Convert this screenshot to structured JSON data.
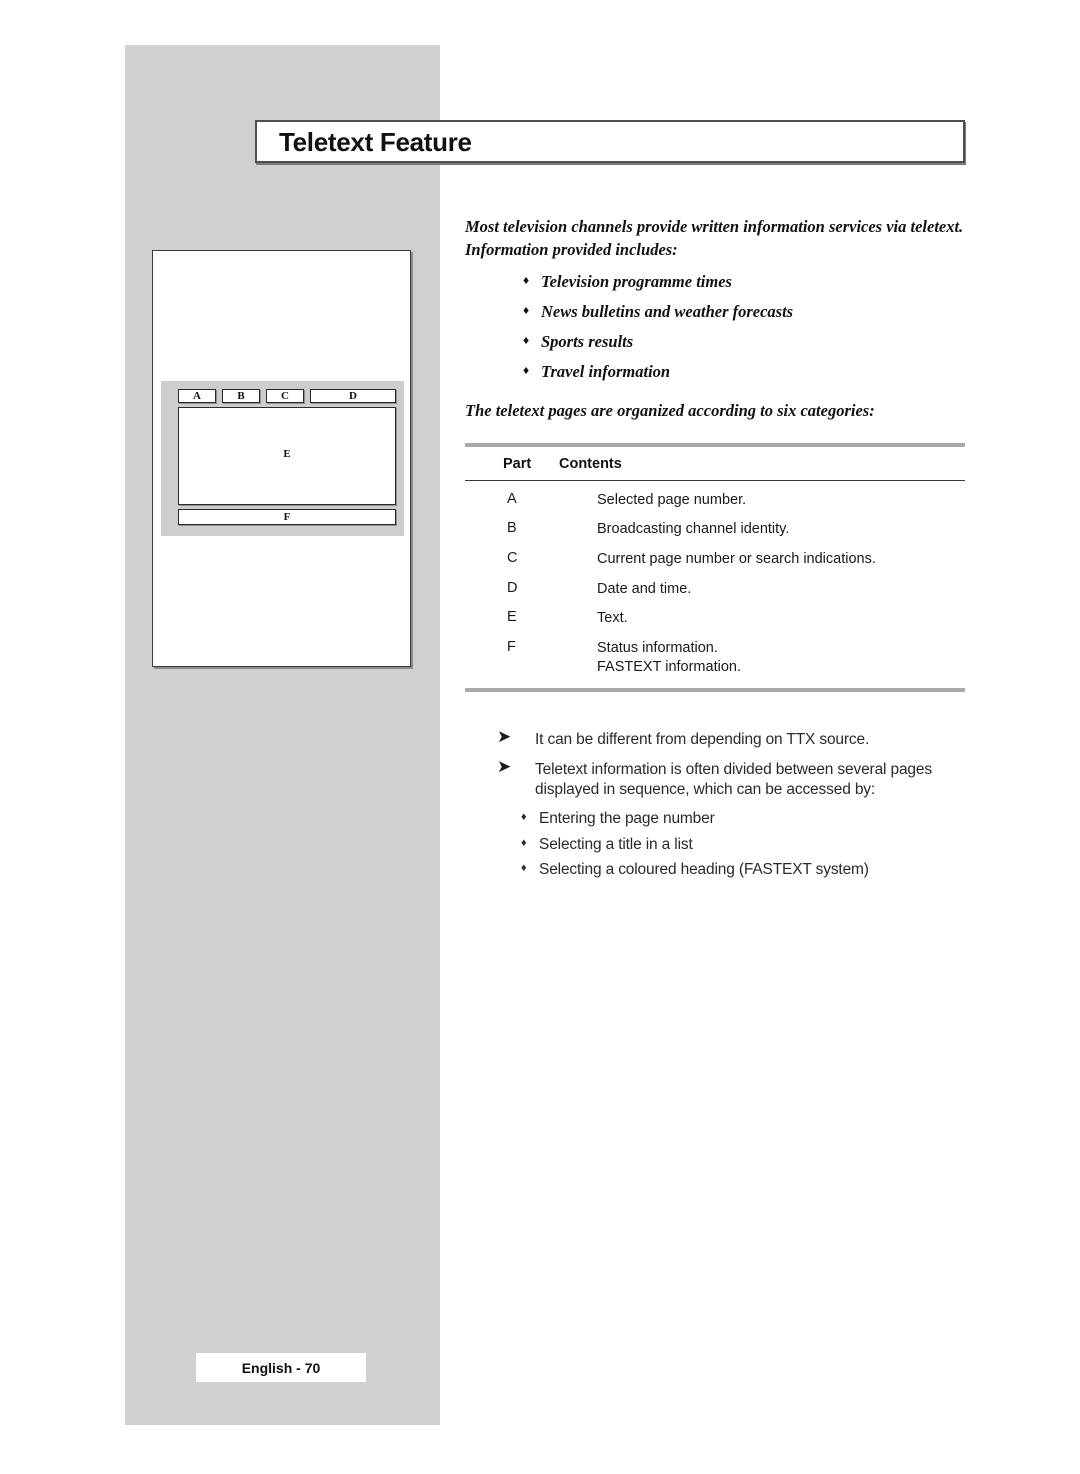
{
  "page": {
    "title": "Teletext Feature",
    "footer_label": "English - 70"
  },
  "figure": {
    "name": "teletext-screen-layout-diagram",
    "boxes": [
      {
        "id": "A",
        "label": "A"
      },
      {
        "id": "B",
        "label": "B"
      },
      {
        "id": "C",
        "label": "C"
      },
      {
        "id": "D",
        "label": "D"
      },
      {
        "id": "E",
        "label": "E"
      },
      {
        "id": "F",
        "label": "F"
      }
    ]
  },
  "intro": {
    "paragraph": "Most television channels provide written information services via teletext. Information provided includes:",
    "bullet_glyph": "♦",
    "items": [
      "Television programme times",
      "News bulletins and weather forecasts",
      "Sports results",
      "Travel information"
    ]
  },
  "section": {
    "lead": "The teletext pages are organized according to six categories:"
  },
  "table": {
    "headers": {
      "part": "Part",
      "contents": "Contents"
    },
    "rows": [
      {
        "part": "A",
        "contents": "Selected page number."
      },
      {
        "part": "B",
        "contents": "Broadcasting channel identity."
      },
      {
        "part": "C",
        "contents": "Current page number or search indications."
      },
      {
        "part": "D",
        "contents": "Date and time."
      },
      {
        "part": "E",
        "contents": "Text."
      },
      {
        "part": "F",
        "contents": "Status information.\nFASTEXT information."
      }
    ]
  },
  "notes": {
    "arrow_glyph": "➤",
    "bullet_glyph": "♦",
    "items": [
      {
        "text": "It can be different from depending on TTX source."
      },
      {
        "text": "Teletext information is often divided between several pages displayed in sequence, which can be accessed by:"
      }
    ],
    "sub_items": [
      "Entering the page number",
      "Selecting a title in a list",
      "Selecting a coloured heading (FASTEXT system)"
    ]
  }
}
